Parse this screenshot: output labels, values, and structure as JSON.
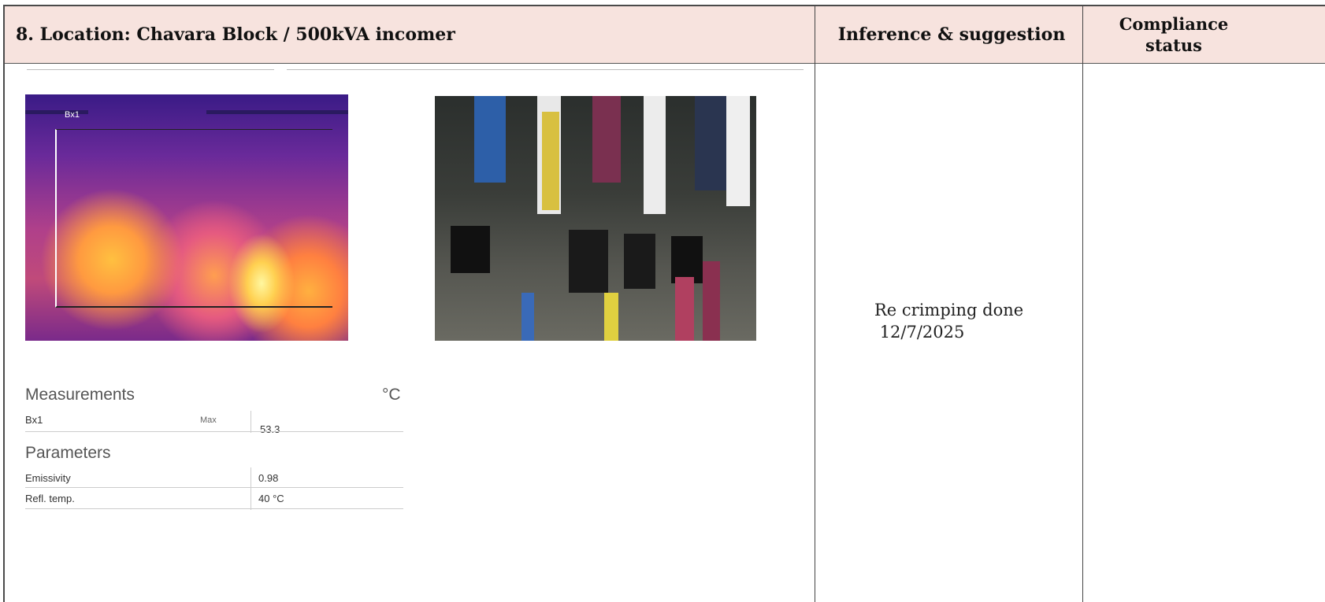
{
  "header": {
    "location": "8.  Location: Chavara Block / 500kVA incomer",
    "inference_heading": "Inference & suggestion",
    "compliance_heading_line1": "Compliance",
    "compliance_heading_line2": "status"
  },
  "thermal_image": {
    "box_label": "Bx1"
  },
  "measurements": {
    "title": "Measurements",
    "unit": "°C",
    "rows": [
      {
        "name": "Bx1",
        "stat": "Max",
        "value": "53.3"
      }
    ]
  },
  "parameters": {
    "title": "Parameters",
    "rows": [
      {
        "name": "Emissivity",
        "value": "0.98"
      },
      {
        "name": "Refl. temp.",
        "value": "40 °C"
      }
    ]
  },
  "inference": {
    "line1": "Re crimping done",
    "line2": "12/7/2025"
  },
  "compliance": {
    "status": ""
  },
  "colors": {
    "header_bg": "#f7e3de",
    "border": "#444444"
  }
}
